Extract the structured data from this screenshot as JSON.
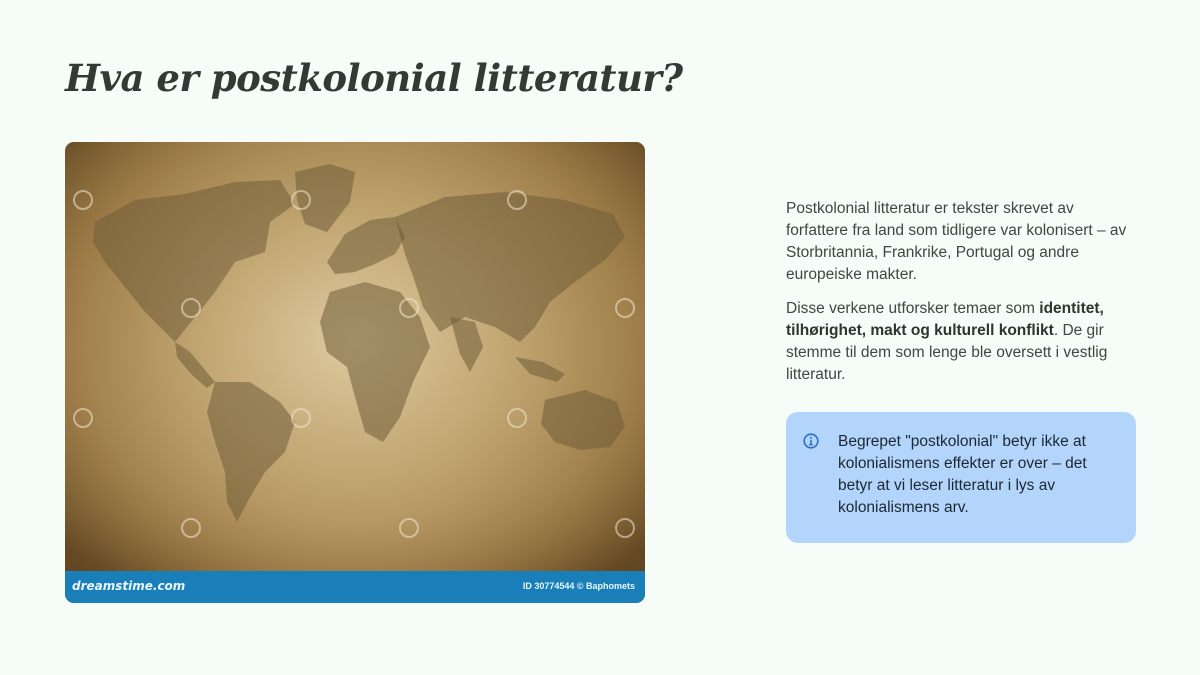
{
  "slide": {
    "title": "Hva er postkolonial litteratur?"
  },
  "image": {
    "brand": "dreamstime.com",
    "credit": "ID 30774544 © Baphomets"
  },
  "body": {
    "paragraph1": "Postkolonial litteratur er tekster skrevet av forfattere fra land som tidligere var kolonisert – av Storbritannia, Frankrike, Portugal og andre europeiske makter.",
    "paragraph2_before": "Disse verkene utforsker temaer som ",
    "paragraph2_bold": "identitet, tilhørighet, makt og kulturell konflikt",
    "paragraph2_after": ". De gir stemme til dem som lenge ble oversett i vestlig litteratur."
  },
  "callout": {
    "icon": "info-icon",
    "text": "Begrepet \"postkolonial\" betyr ikke at kolonialismens effekter er over – det betyr at vi leser litteratur i lys av kolonialismens arv.",
    "color": "#b4d5fb"
  },
  "colors": {
    "background": "#f6fcf7",
    "footer": "#1a7fb8",
    "title": "#333a35"
  }
}
